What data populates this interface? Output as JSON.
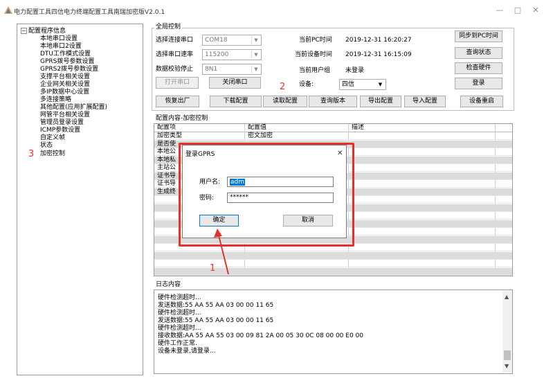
{
  "window": {
    "title": "电力配置工具四信电力终端配置工具南瑞加密版V2.0.1",
    "min_icon": "minimize-icon",
    "max_icon": "maximize-icon",
    "close_icon": "close-icon",
    "min_glyph": "—",
    "max_glyph": "□",
    "close_glyph": "✕"
  },
  "tree": {
    "collapse_glyph": "−",
    "root": "配置程序信息",
    "items": [
      "本地串口设置",
      "本地串口2设置",
      "DTU工作模式设置",
      "GPRS拨号参数设置",
      "GPRS2拨号参数设置",
      "支撑平台相关设置",
      "企业网关相关设置",
      "多IP数据中心设置",
      "多连接策略",
      "其他配置(应用扩展配置)",
      "网管平台相关设置",
      "管理员登录设置",
      "ICMP参数设置",
      "自定义帧",
      "状态",
      "加密控制"
    ],
    "annotation": "3"
  },
  "global": {
    "group_label": "全局控制",
    "port_label": "选择连接串口",
    "port_value": "COM18",
    "baud_label": "选择串口速率",
    "baud_value": "115200",
    "parity_label": "数据校验停止",
    "parity_value": "8N1",
    "open_port": "打开串口",
    "close_port": "关闭串口",
    "restore": "恢复出厂",
    "download": "下载配置",
    "read_config": "读取配置",
    "query_version": "查询版本",
    "export_config": "导出配置",
    "import_config": "导入配置",
    "pc_time_label": "当前PC时间",
    "pc_time_value": "2019-12-31 16:20:27",
    "device_time_label": "当前设备时间",
    "device_time_value": "2019-12-31 16:15:09",
    "user_group_label": "当前用户组",
    "user_group_value": "未登录",
    "device_label": "设备:",
    "device_value": "四信",
    "sync_pc_time": "同步到PC时间",
    "query_status": "查询状态",
    "check_hardware": "检查硬件",
    "login": "登录",
    "restart_device": "设备重启",
    "annotation": "2"
  },
  "config": {
    "group_label": "配置内容-加密控制",
    "headers": [
      "配置项",
      "配置值",
      "描述"
    ],
    "rows": [
      {
        "item": "加密类型",
        "value": "密文加密",
        "desc": ""
      },
      {
        "item": "是否使",
        "value": "",
        "desc": ""
      },
      {
        "item": "本地公",
        "value": "",
        "desc": ""
      },
      {
        "item": "本地私",
        "value": "",
        "desc": ""
      },
      {
        "item": "主站公",
        "value": "",
        "desc": ""
      },
      {
        "item": "证书导",
        "value": "",
        "desc": ""
      },
      {
        "item": "证书导",
        "value": "",
        "desc": ""
      },
      {
        "item": "生成终",
        "value": "",
        "desc": ""
      },
      {
        "item": "",
        "value": "",
        "desc": ""
      },
      {
        "item": "",
        "value": "",
        "desc": ""
      },
      {
        "item": "",
        "value": "",
        "desc": ""
      },
      {
        "item": "",
        "value": "",
        "desc": ""
      },
      {
        "item": "",
        "value": "",
        "desc": ""
      },
      {
        "item": "",
        "value": "",
        "desc": ""
      },
      {
        "item": "",
        "value": "",
        "desc": ""
      },
      {
        "item": "",
        "value": "",
        "desc": ""
      },
      {
        "item": "",
        "value": "",
        "desc": ""
      },
      {
        "item": "",
        "value": "",
        "desc": ""
      }
    ]
  },
  "log": {
    "group_label": "日志内容",
    "lines": [
      "硬件检测超时...",
      "发送数据:55 AA 55 AA 03 00 00 11 65",
      "硬件检测超时...",
      "发送数据:55 AA 55 AA 03 00 00 11 65",
      "硬件检测超时...",
      "接收数据:AA 55 AA 55 03 00 09 81 2A 00 05 30 0C 08 00 00 E0 00",
      "硬件工作正常.",
      "设备未登录,请登录..."
    ]
  },
  "dialog": {
    "title": "登录GPRS",
    "close_glyph": "✕",
    "username_label": "用户名:",
    "username_value": "adm",
    "password_label": "密码:",
    "password_value": "******",
    "ok": "确定",
    "cancel": "取消"
  },
  "annotations": {
    "arrow_label": "1",
    "color": "#e8302b"
  }
}
